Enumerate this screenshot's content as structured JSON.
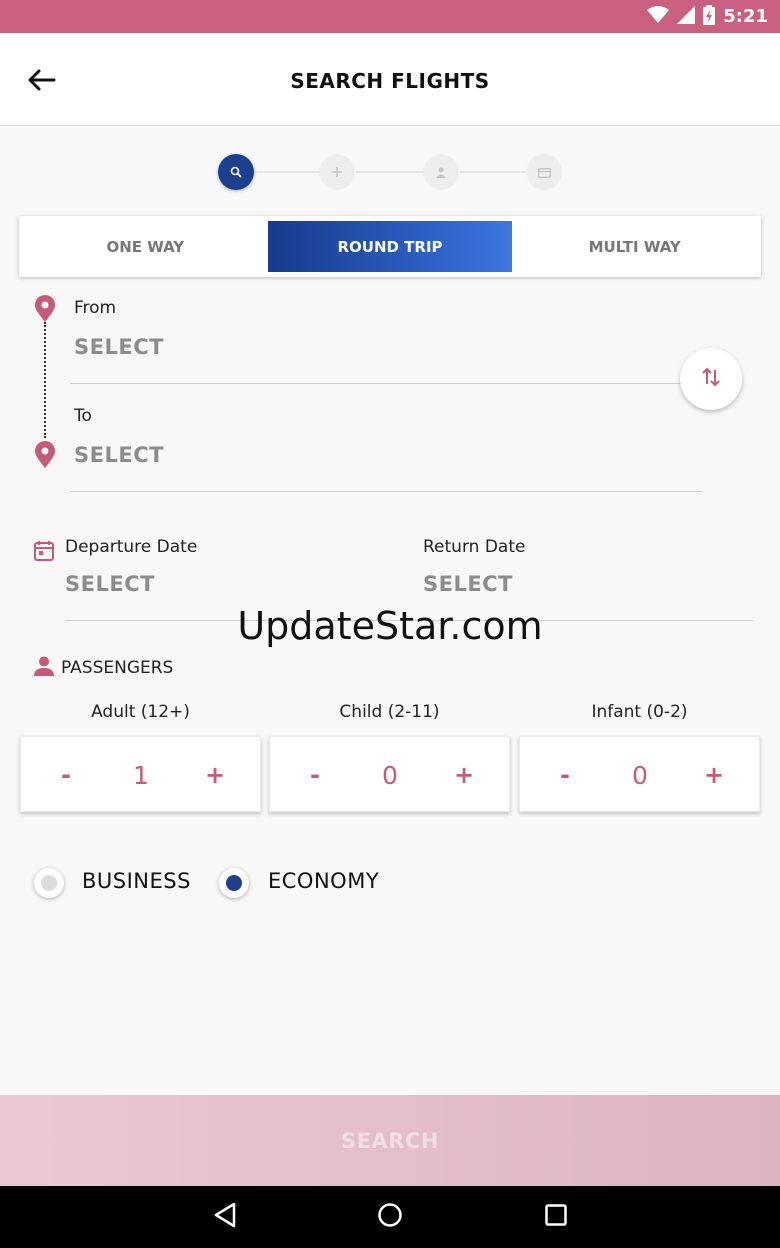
{
  "status_bar": {
    "time": "5:21",
    "icons": [
      "wifi-icon",
      "signal-icon",
      "battery-icon"
    ]
  },
  "header": {
    "title": "SEARCH FLIGHTS",
    "back_icon": "arrow-left-icon"
  },
  "stepper": {
    "steps": [
      "search-icon",
      "plus-icon",
      "person-icon",
      "card-icon"
    ],
    "active_index": 0
  },
  "trip_type": {
    "tabs": [
      "ONE WAY",
      "ROUND TRIP",
      "MULTI WAY"
    ],
    "selected": "ROUND TRIP"
  },
  "route": {
    "from_label": "From",
    "from_value": "SELECT",
    "to_label": "To",
    "to_value": "SELECT",
    "swap_icon": "swap-vertical-icon"
  },
  "dates": {
    "departure_label": "Departure Date",
    "departure_value": "SELECT",
    "return_label": "Return Date",
    "return_value": "SELECT"
  },
  "watermark": "UpdateStar.com",
  "passengers": {
    "title": "PASSENGERS",
    "groups": [
      {
        "label": "Adult (12+)",
        "minus": "-",
        "value": "1",
        "plus": "+"
      },
      {
        "label": "Child (2-11)",
        "minus": "-",
        "value": "0",
        "plus": "+"
      },
      {
        "label": "Infant (0-2)",
        "minus": "-",
        "value": "0",
        "plus": "+"
      }
    ]
  },
  "cabin_class": {
    "options": [
      "BUSINESS",
      "ECONOMY"
    ],
    "selected": "ECONOMY"
  },
  "search_button": {
    "label": "SEARCH"
  },
  "colors": {
    "status_bar": "#c9607f",
    "accent": "#c75a79",
    "primary_blue": "#1c3f8f",
    "search_bar": "#e3bfcb"
  }
}
